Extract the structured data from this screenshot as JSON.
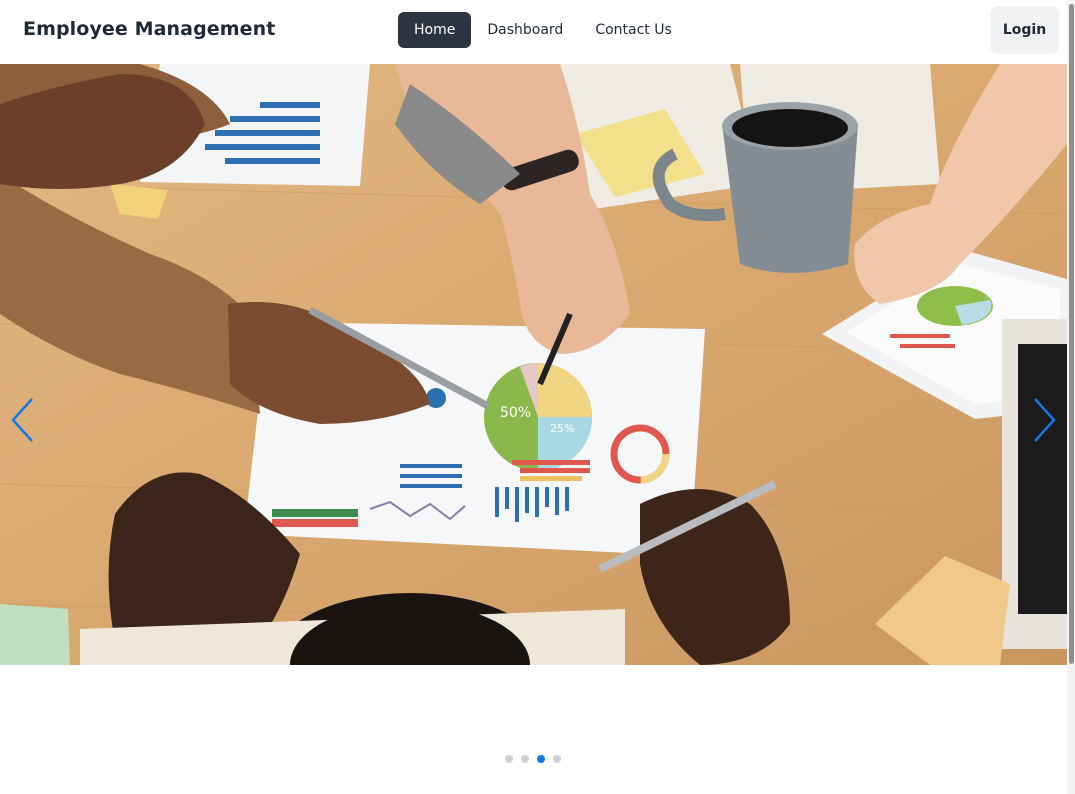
{
  "navbar": {
    "brand": "Employee Management",
    "links": [
      {
        "label": "Home",
        "active": true
      },
      {
        "label": "Dashboard",
        "active": false
      },
      {
        "label": "Contact Us",
        "active": false
      }
    ],
    "login_label": "Login"
  },
  "carousel": {
    "slide_count": 4,
    "active_index": 2,
    "image_text": {
      "pie_large": "50%",
      "pie_small": "25%"
    },
    "arrow_color": "#1478e6"
  },
  "colors": {
    "nav_active_bg": "#2b3441",
    "indicator_active": "#1478e6",
    "indicator_inactive": "#cfd2d6",
    "login_bg": "#f1f2f4"
  }
}
